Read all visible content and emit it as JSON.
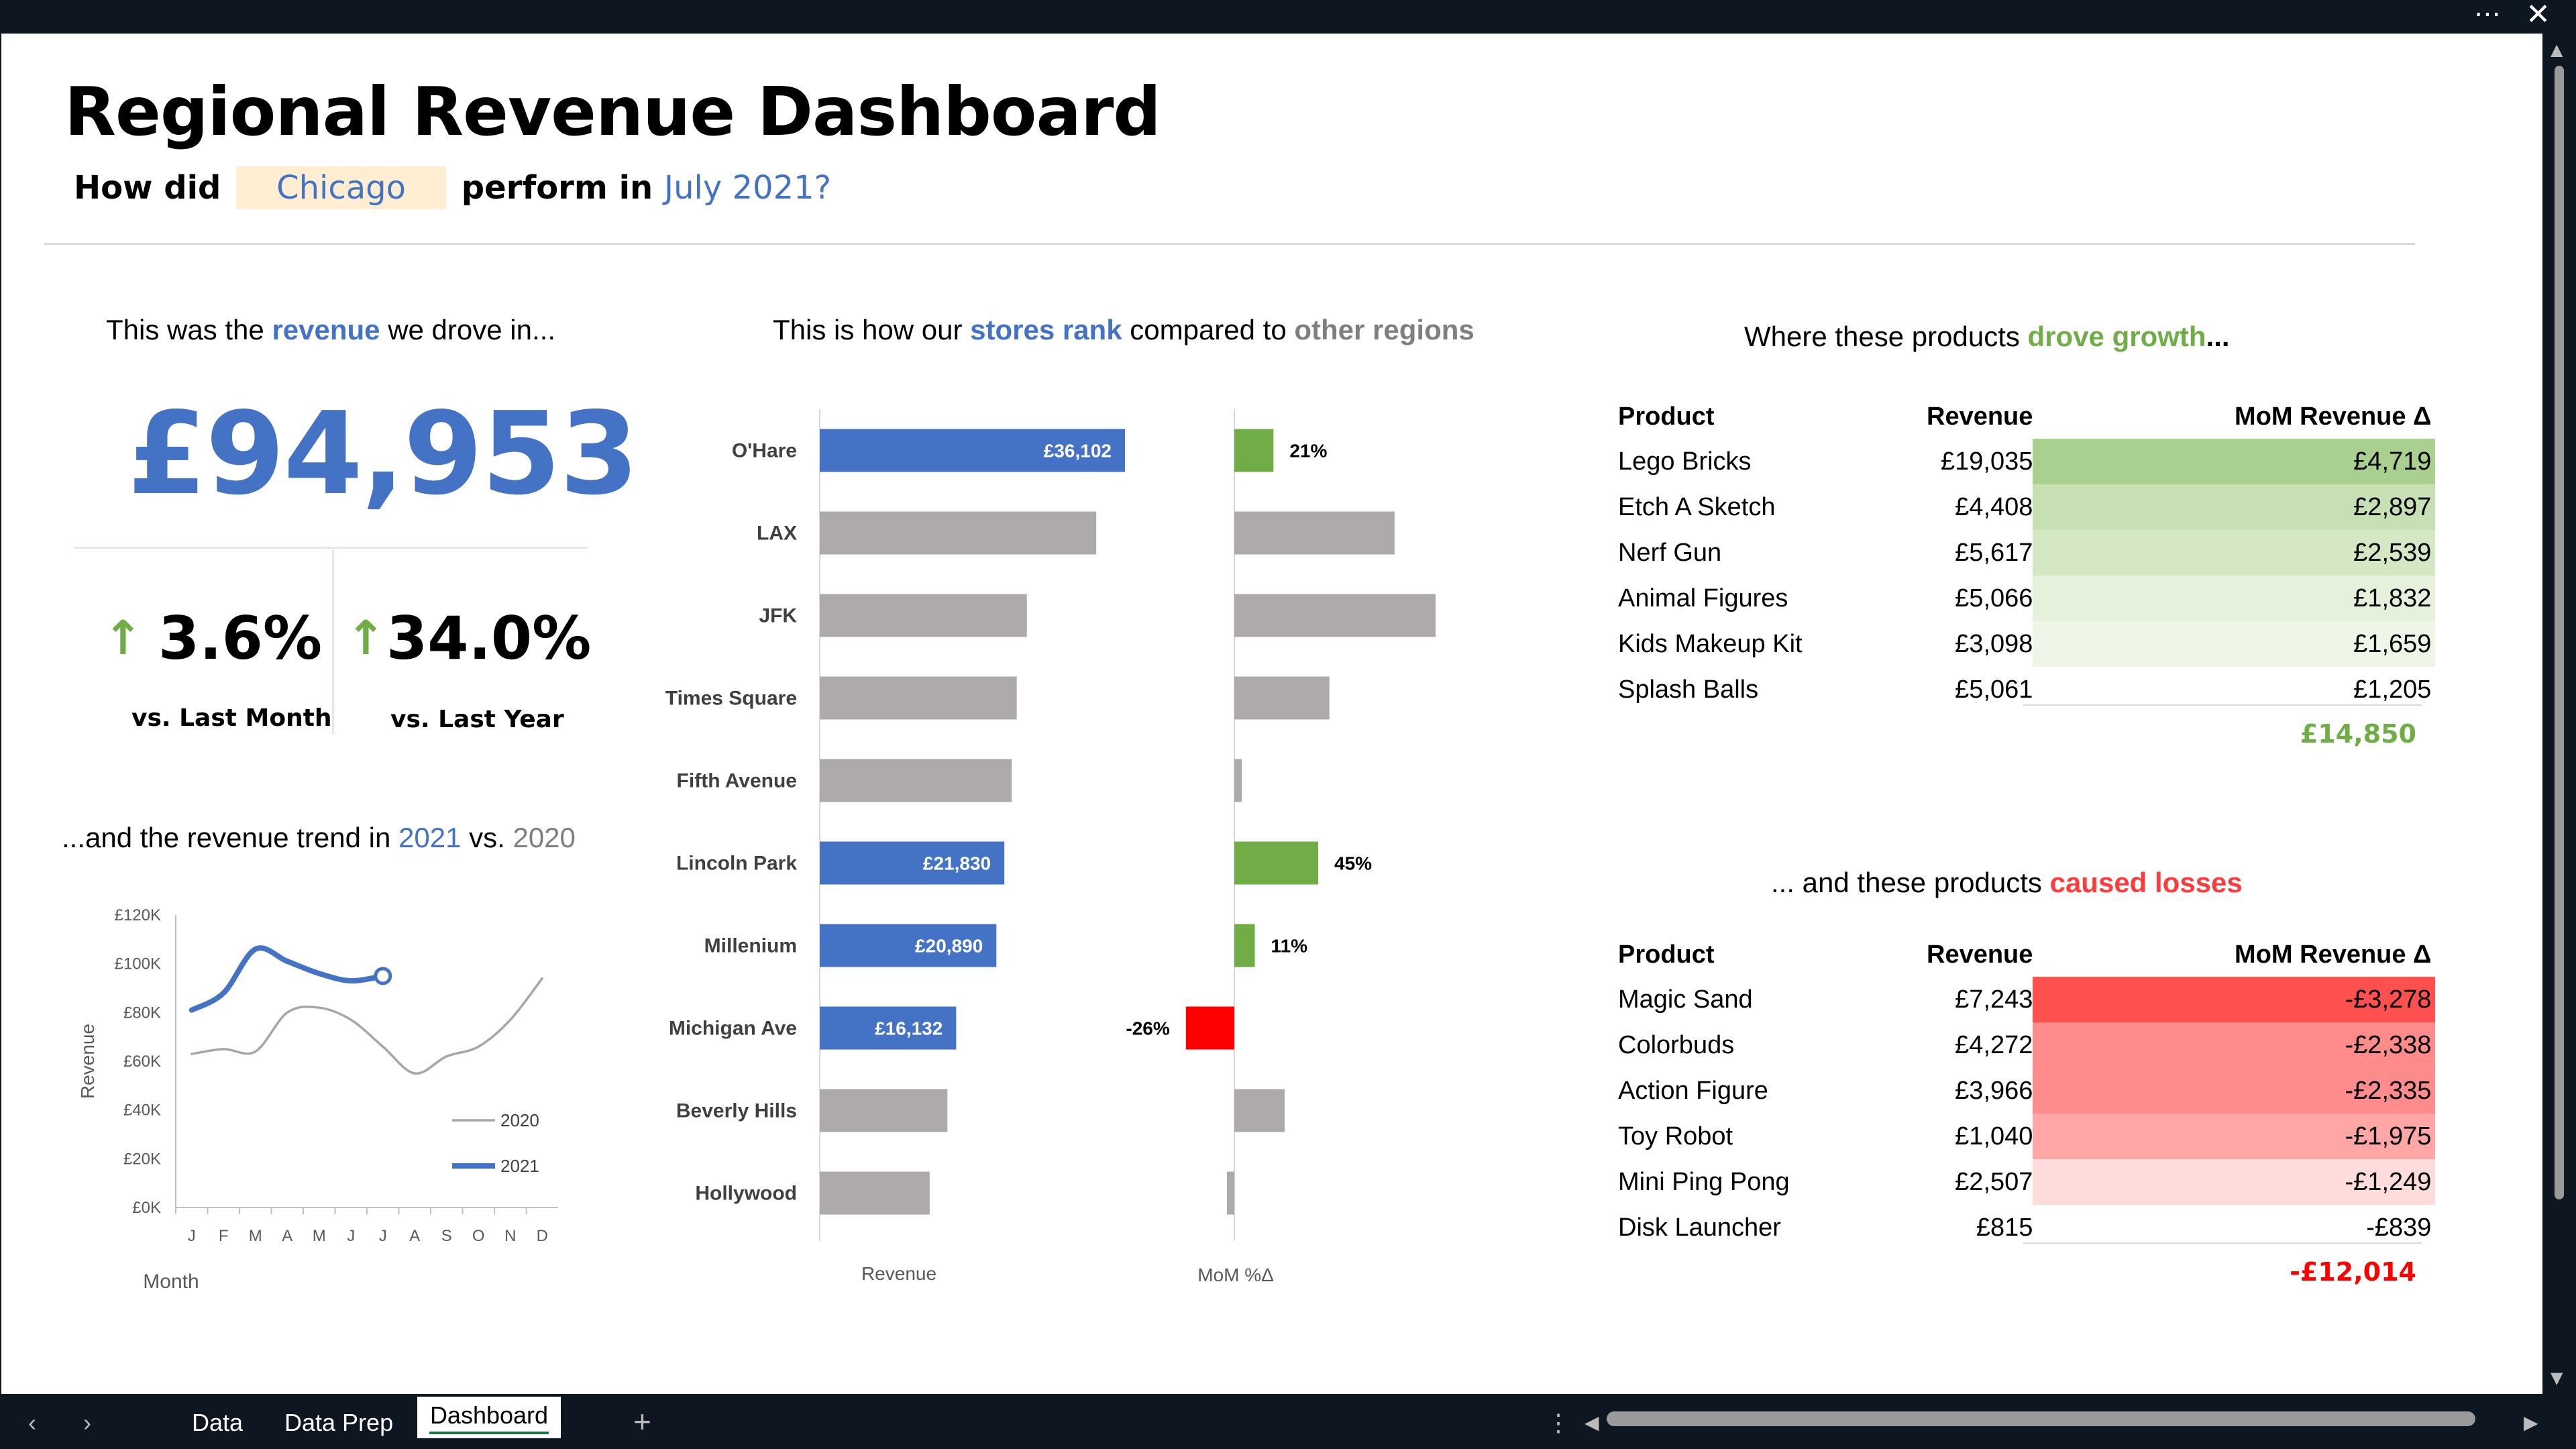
{
  "title": "Regional Revenue Dashboard",
  "question": {
    "prefix": "How did",
    "city": "Chicago",
    "middle": "perform in",
    "period": "July 2021?"
  },
  "kpi": {
    "heading_pre": "This was the",
    "heading_key": "revenue",
    "heading_post": "we drove in...",
    "revenue": "£94,953",
    "mom_pct": "3.6%",
    "mom_label": "vs. Last Month",
    "yoy_pct": "34.0%",
    "yoy_label": "vs. Last Year"
  },
  "trend": {
    "heading_pre": "...and the revenue trend in",
    "year_a": "2021",
    "vs": "vs.",
    "year_b": "2020"
  },
  "rank": {
    "heading_pre": "This is how our",
    "heading_key": "stores rank",
    "heading_mid": "compared to",
    "heading_other": "other regions"
  },
  "growth": {
    "heading_pre": "Where these products",
    "heading_key": "drove growth",
    "heading_post": "..."
  },
  "losses": {
    "heading_pre": "... and these products",
    "heading_key": "caused losses"
  },
  "chart_data": [
    {
      "type": "line",
      "title": "",
      "xlabel": "Month",
      "ylabel": "Revenue",
      "x": [
        "J",
        "F",
        "M",
        "A",
        "M",
        "J",
        "J",
        "A",
        "S",
        "O",
        "N",
        "D"
      ],
      "ylim": [
        0,
        120000
      ],
      "yticks": [
        "£120K",
        "£100K",
        "£80K",
        "£60K",
        "£40K",
        "£20K",
        "£0K"
      ],
      "legend_position": "bottom-right",
      "series": [
        {
          "name": "2020",
          "color": "#a6a6a6",
          "values": [
            63000,
            65000,
            64000,
            80000,
            82000,
            77000,
            66000,
            55000,
            62000,
            66000,
            77000,
            94000
          ]
        },
        {
          "name": "2021",
          "color": "#4472c4",
          "values": [
            81000,
            88000,
            106000,
            101000,
            96000,
            93000,
            95000
          ]
        }
      ]
    },
    {
      "type": "bar",
      "orientation": "horizontal",
      "xlabel": "Revenue",
      "categories": [
        "O'Hare",
        "LAX",
        "JFK",
        "Times Square",
        "Fifth Avenue",
        "Lincoln Park",
        "Millenium",
        "Michigan Ave",
        "Beverly Hills",
        "Hollywood"
      ],
      "values": [
        36102,
        32700,
        24500,
        23300,
        22700,
        21830,
        20890,
        16132,
        15100,
        13000
      ],
      "labels": [
        "£36,102",
        "",
        "",
        "",
        "",
        "£21,830",
        "£20,890",
        "£16,132",
        "",
        ""
      ],
      "highlight": [
        true,
        false,
        false,
        false,
        false,
        true,
        true,
        true,
        false,
        false
      ],
      "highlight_color": "#4472c4",
      "other_color": "#aeaaaa"
    },
    {
      "type": "bar",
      "orientation": "horizontal",
      "xlabel": "MoM %Δ",
      "categories": [
        "O'Hare",
        "LAX",
        "JFK",
        "Times Square",
        "Fifth Avenue",
        "Lincoln Park",
        "Millenium",
        "Michigan Ave",
        "Beverly Hills",
        "Hollywood"
      ],
      "values": [
        21,
        86,
        108,
        51,
        4,
        45,
        11,
        -26,
        27,
        -4
      ],
      "labels": [
        "21%",
        "",
        "",
        "",
        "",
        "45%",
        "11%",
        "-26%",
        "",
        ""
      ],
      "highlight": [
        true,
        false,
        false,
        false,
        false,
        true,
        true,
        true,
        false,
        false
      ],
      "positive_color": "#70ad47",
      "negative_color": "#ff0000",
      "other_color": "#aeaaaa"
    }
  ],
  "growth_table": {
    "headers": [
      "Product",
      "Revenue",
      "MoM Revenue Δ"
    ],
    "rows": [
      {
        "product": "Lego Bricks",
        "revenue": "£19,035",
        "delta": "£4,719",
        "bg": "#a9d08e"
      },
      {
        "product": "Etch A Sketch",
        "revenue": "£4,408",
        "delta": "£2,897",
        "bg": "#c6e0b4"
      },
      {
        "product": "Nerf Gun",
        "revenue": "£5,617",
        "delta": "£2,539",
        "bg": "#d4e8c4"
      },
      {
        "product": "Animal Figures",
        "revenue": "£5,066",
        "delta": "£1,832",
        "bg": "#e6f1dc"
      },
      {
        "product": "Kids Makeup Kit",
        "revenue": "£3,098",
        "delta": "£1,659",
        "bg": "#eef6e8"
      },
      {
        "product": "Splash Balls",
        "revenue": "£5,061",
        "delta": "£1,205",
        "bg": "#ffffff"
      }
    ],
    "total": "£14,850"
  },
  "loss_table": {
    "headers": [
      "Product",
      "Revenue",
      "MoM Revenue Δ"
    ],
    "rows": [
      {
        "product": "Magic Sand",
        "revenue": "£7,243",
        "delta": "-£3,278",
        "bg": "#ff5050"
      },
      {
        "product": "Colorbuds",
        "revenue": "£4,272",
        "delta": "-£2,338",
        "bg": "#ff8b8b"
      },
      {
        "product": "Action Figure",
        "revenue": "£3,966",
        "delta": "-£2,335",
        "bg": "#ff8c8c"
      },
      {
        "product": "Toy Robot",
        "revenue": "£1,040",
        "delta": "-£1,975",
        "bg": "#ffa7a7"
      },
      {
        "product": "Mini Ping Pong",
        "revenue": "£2,507",
        "delta": "-£1,249",
        "bg": "#ffdcdc"
      },
      {
        "product": "Disk Launcher",
        "revenue": "£815",
        "delta": "-£839",
        "bg": "#ffffff"
      }
    ],
    "total": "-£12,014"
  },
  "tabs": {
    "items": [
      "Data",
      "Data Prep",
      "Dashboard"
    ],
    "active": "Dashboard",
    "add": "+"
  }
}
